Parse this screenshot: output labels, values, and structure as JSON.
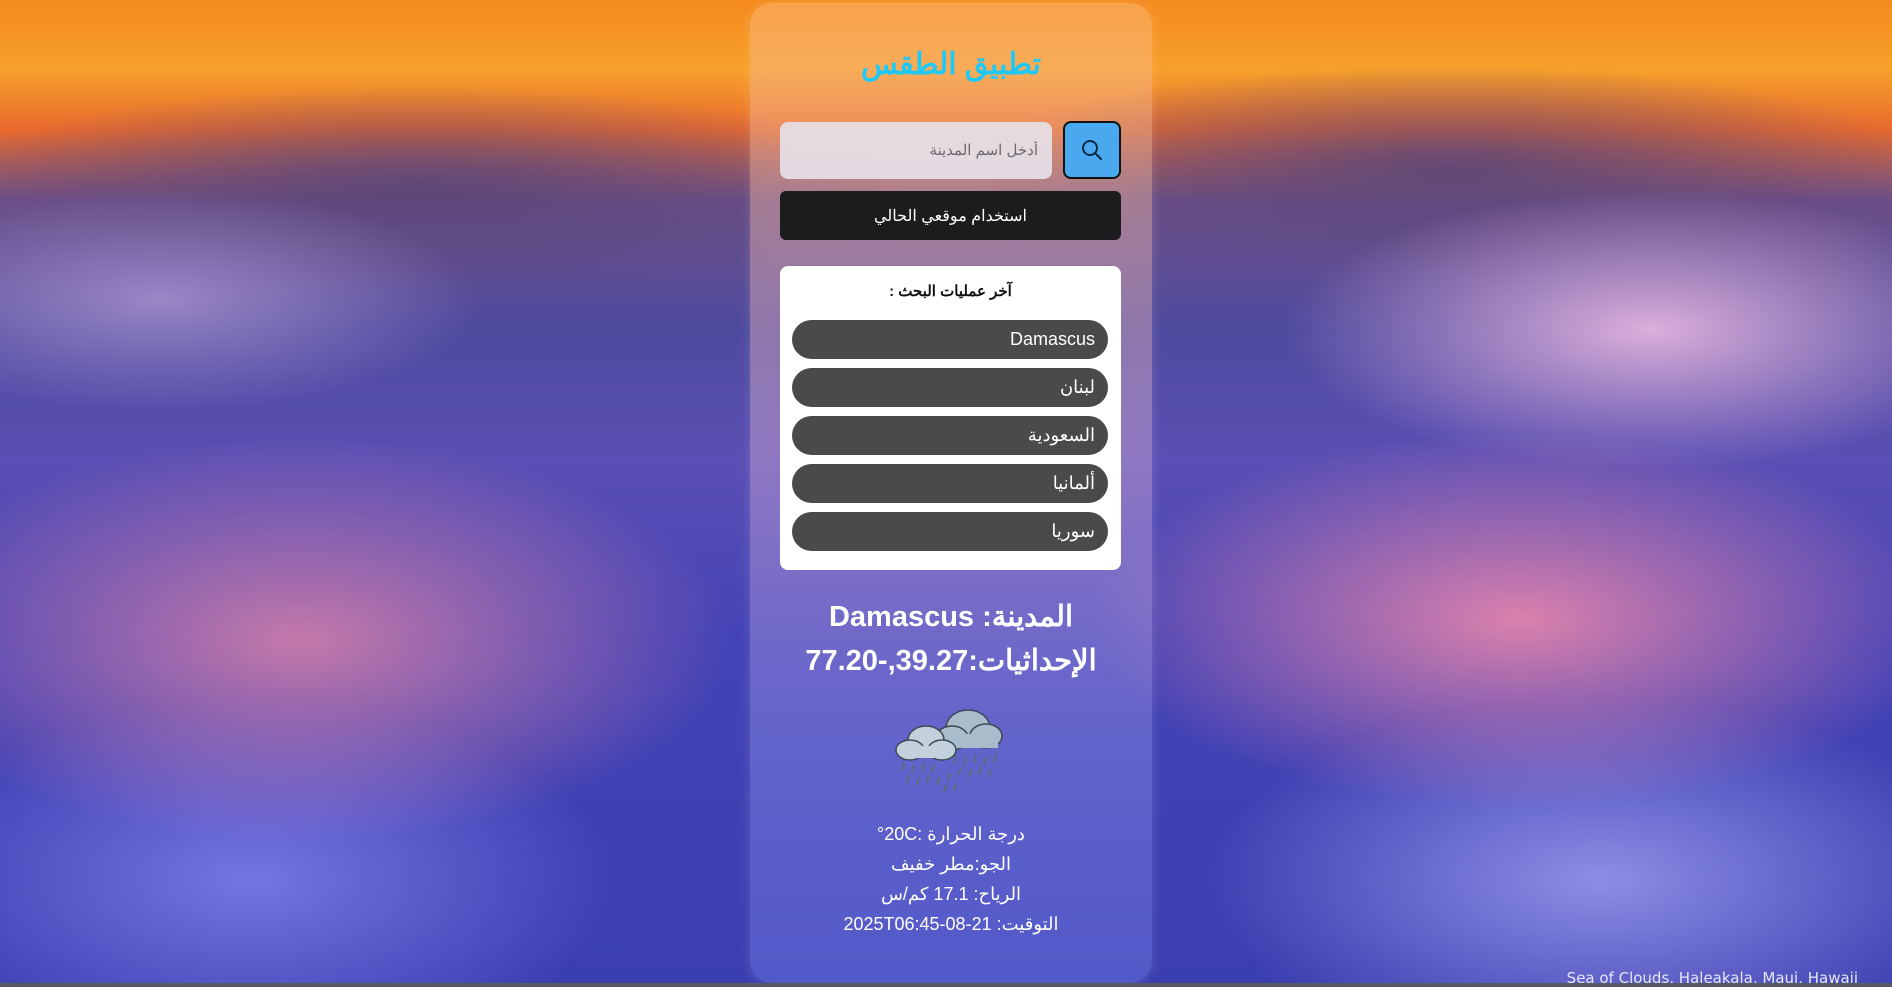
{
  "app": {
    "title": "تطبيق الطقس",
    "accent_color": "#20c8f5"
  },
  "search": {
    "placeholder": "أدخل اسم المدينة",
    "value": "",
    "button_icon": "search-icon"
  },
  "location_button": {
    "label": "استخدام موقعي الحالي"
  },
  "history": {
    "title": "آخر عمليات البحث :",
    "items": [
      "Damascus",
      "لبنان",
      "السعودية",
      "ألمانيا",
      "سوريا"
    ]
  },
  "result": {
    "city_line": "المدينة: Damascus",
    "coords_line": "الإحداثيات:39.27,-77.20",
    "weather_icon": "rain-cloud-icon",
    "temperature": "درجة الحرارة :20C°",
    "condition": "الجو:مطر خفيف",
    "wind": "الرياح: 17.1 كم/س",
    "time": "التوقيت: 21-08-2025T06:45"
  },
  "background": {
    "caption": "Sea of Clouds, Haleakala, Maui, Hawaii"
  }
}
